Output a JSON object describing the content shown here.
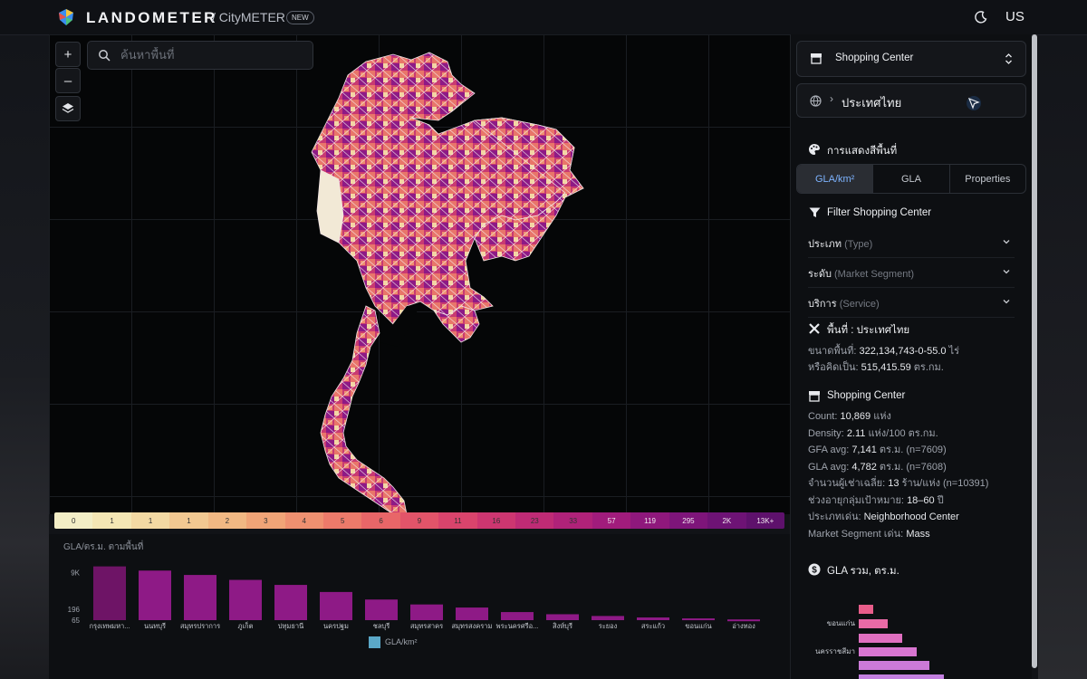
{
  "header": {
    "brand": "LANDOMETER",
    "subbrand": "/ CityMETER",
    "badge": "NEW",
    "lang": "US"
  },
  "search": {
    "placeholder": "ค้นหาพื้นที่"
  },
  "map_controls": {
    "zoom_in": "+",
    "zoom_out": "–"
  },
  "legend": {
    "labels": [
      "0",
      "1",
      "1",
      "1",
      "2",
      "3",
      "4",
      "5",
      "6",
      "9",
      "11",
      "16",
      "23",
      "33",
      "57",
      "119",
      "295",
      "2K",
      "13K+"
    ],
    "colors": [
      "#f3eec6",
      "#f4e6b4",
      "#f3d9a3",
      "#f2c891",
      "#f1b883",
      "#f0a477",
      "#ee9070",
      "#ec7a6a",
      "#e86668",
      "#e25469",
      "#d9446c",
      "#cd3670",
      "#bf2b75",
      "#b02279",
      "#a11c7c",
      "#8f187c",
      "#7e157a",
      "#6e1375",
      "#5e116c"
    ]
  },
  "chart_data": {
    "type": "bar",
    "title": "GLA/ตร.ม. ตามพื้นที่",
    "categories": [
      "กรุงเทพมหา...",
      "นนทบุรี",
      "สมุทรปราการ",
      "ภูเก็ต",
      "ปทุมธานี",
      "นครปฐม",
      "ชลบุรี",
      "สมุทรสาคร",
      "สมุทรสงคราม",
      "พระนครศรีอ...",
      "สิงห์บุรี",
      "ระยอง",
      "สระแก้ว",
      "ขอนแก่น",
      "อ่างทอง"
    ],
    "values": [
      17000,
      11000,
      7000,
      4200,
      2500,
      1200,
      550,
      330,
      240,
      150,
      120,
      100,
      86,
      78,
      70
    ],
    "ytick_labels": [
      "9K",
      "196",
      "65"
    ],
    "legend": "GLA/km²",
    "bar_color": "#8e1a86"
  },
  "panel": {
    "type_select": "Shopping Center",
    "location": "ประเทศไทย",
    "color_section_title": "การแสดงสีพื้นที่",
    "tabs": [
      "GLA/km²",
      "GLA",
      "Properties"
    ],
    "filter_title": "Filter Shopping Center",
    "filters": [
      {
        "label": "ประเภท",
        "hint": "(Type)"
      },
      {
        "label": "ระดับ",
        "hint": "(Market Segment)"
      },
      {
        "label": "บริการ",
        "hint": "(Service)"
      }
    ],
    "area": {
      "title": "พื้นที่ : ประเทศไทย",
      "size_label": "ขนาดพื้นที่:",
      "size_value": "322,134,743-0-55.0",
      "size_unit": "ไร่",
      "equiv_label": "หรือคิดเป็น:",
      "equiv_value": "515,415.59",
      "equiv_unit": "ตร.กม."
    },
    "stats": {
      "title": "Shopping Center",
      "lines": [
        {
          "label": "Count:",
          "value": "10,869",
          "unit": "แห่ง"
        },
        {
          "label": "Density:",
          "value": "2.11",
          "unit": "แห่ง/100 ตร.กม."
        },
        {
          "label": "GFA avg:",
          "value": "7,141",
          "unit": "ตร.ม. (n=7609)"
        },
        {
          "label": "GLA avg:",
          "value": "4,782",
          "unit": "ตร.ม. (n=7608)"
        },
        {
          "label": "จำนวนผู้เช่าเฉลี่ย:",
          "value": "13",
          "unit": "ร้าน/แห่ง (n=10391)"
        },
        {
          "label": "ช่วงอายุกลุ่มเป้าหมาย:",
          "value": "18–60",
          "unit": "ปี"
        },
        {
          "label": "ประเภทเด่น:",
          "value": "Neighborhood Center",
          "unit": ""
        },
        {
          "label": "Market Segment เด่น:",
          "value": "Mass",
          "unit": ""
        }
      ]
    },
    "gla_total_title": "GLA รวม, ตร.ม.",
    "mini_chart": {
      "labels": [
        "ขอนแก่น",
        "นครราชสีมา"
      ]
    }
  }
}
